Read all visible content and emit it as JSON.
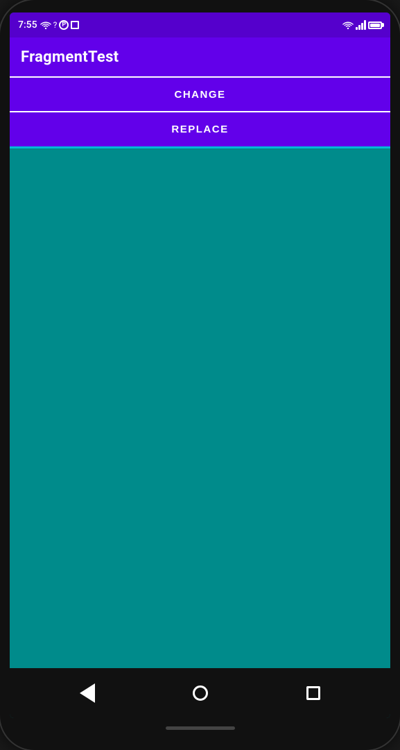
{
  "statusBar": {
    "time": "7:55",
    "wifiLabel": "wifi",
    "signalLabel": "signal",
    "batteryLabel": "battery"
  },
  "appBar": {
    "title": "FragmentTest"
  },
  "buttons": {
    "changeLabel": "CHANGE",
    "replaceLabel": "REPLACE"
  },
  "navBar": {
    "backLabel": "back",
    "homeLabel": "home",
    "recentLabel": "recent"
  },
  "colors": {
    "appBarBg": "#6200ea",
    "statusBarBg": "#5500cc",
    "fragmentBg": "#008b8b",
    "navBarBg": "#111111"
  }
}
